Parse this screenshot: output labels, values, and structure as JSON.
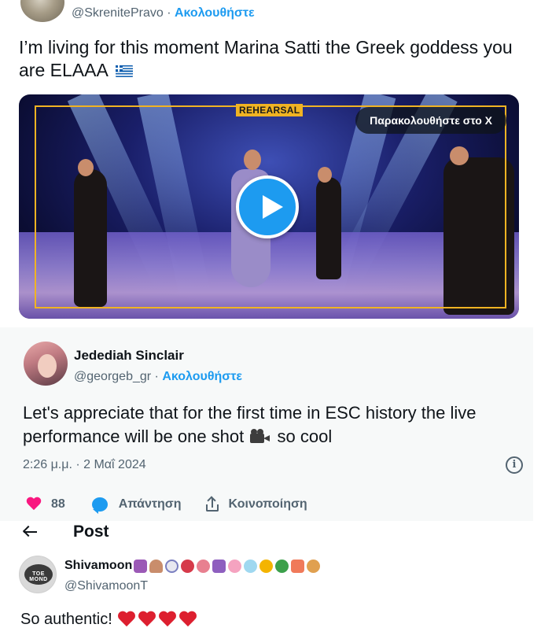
{
  "tweet1": {
    "handle": "@SkrenitePravo",
    "separator": "·",
    "follow_label": "Ακολουθήστε",
    "text": "I’m living for this moment Marina Satti the Greek goddess you are ELAAA",
    "flag_icon": "greece-flag-icon",
    "video": {
      "badge": "REHEARSAL",
      "watch_label": "Παρακολουθήστε στο X",
      "play_icon": "play-icon"
    }
  },
  "tweet2": {
    "name": "Jedediah Sinclair",
    "handle": "@georgeb_gr",
    "separator": "·",
    "follow_label": "Ακολουθήστε",
    "text_before_emoji": "Let's appreciate that for the first time in ESC history the live performance will be one shot",
    "text_after_emoji": "so cool",
    "emoji": "movie-camera-icon",
    "timestamp": "2:26 μ.μ. · 2 Μαΐ 2024",
    "likes": "88",
    "reply_label": "Απάντηση",
    "share_label": "Κοινοποίηση",
    "colors": {
      "like": "#f91880",
      "accent": "#1d9bf0"
    }
  },
  "post_header": {
    "title": "Post"
  },
  "tweet3": {
    "name": "Shivamoon",
    "handle": "@ShivamoonT",
    "text": "So authentic!",
    "hearts": 4,
    "avatar_text": "TOE MOND"
  }
}
